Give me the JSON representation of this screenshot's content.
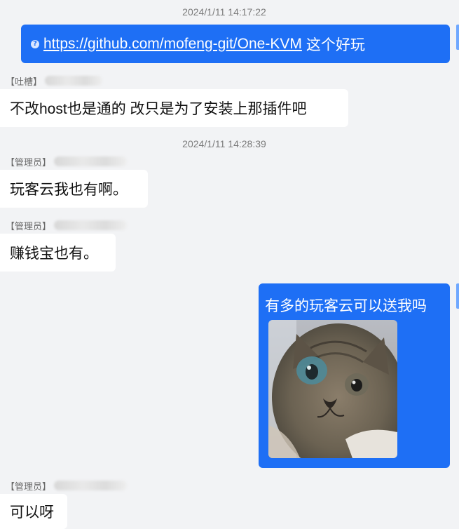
{
  "chat": {
    "timestamp_1": "2024/1/11 14:17:22",
    "timestamp_2": "2024/1/11 14:28:39",
    "msg1": {
      "link_text": "https://github.com/mofeng-git/One-KVM",
      "after_text": "这个好玩"
    },
    "msg2": {
      "sender_role": "【吐槽】",
      "text": "不改host也是通的 改只是为了安装上那插件吧"
    },
    "msg3": {
      "sender_role": "【管理员】",
      "text": "玩客云我也有啊。"
    },
    "msg4": {
      "sender_role": "【管理员】",
      "text": "赚钱宝也有。"
    },
    "msg5": {
      "text": "有多的玩客云可以送我吗",
      "image": "cat-meme-image"
    },
    "msg6": {
      "sender_role": "【管理员】",
      "text": "可以呀"
    }
  },
  "icons": {
    "link_icon": "question-mark-icon"
  },
  "colors": {
    "background": "#f2f3f5",
    "outgoing_bubble": "#1e6ff5",
    "incoming_bubble": "#ffffff"
  }
}
